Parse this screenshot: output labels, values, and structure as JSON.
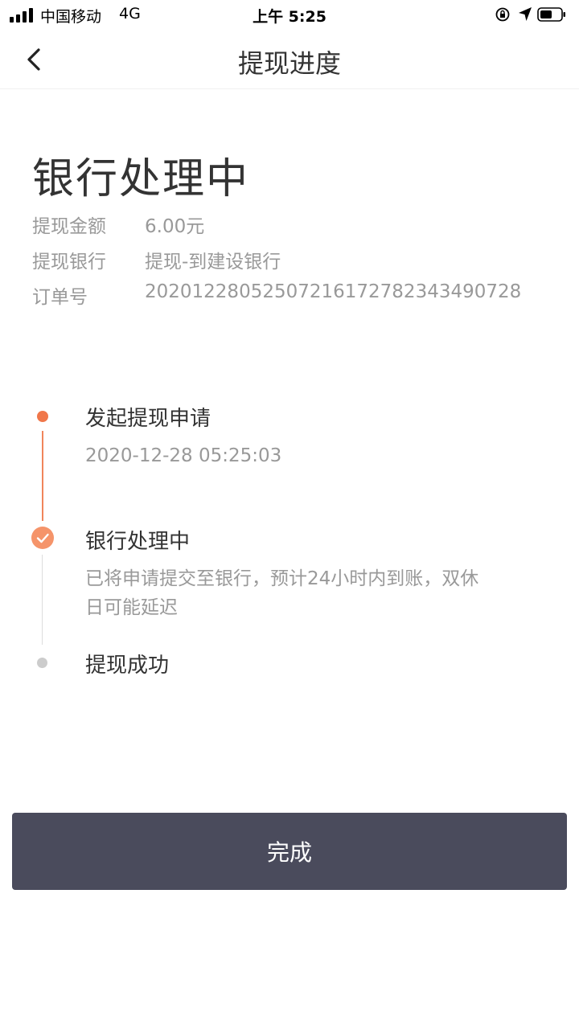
{
  "status_bar": {
    "carrier": "中国移动",
    "network": "4G",
    "time": "上午 5:25"
  },
  "nav": {
    "title": "提现进度",
    "back_icon": "chevron-left-icon"
  },
  "withdrawal": {
    "status": "银行处理中",
    "rows": [
      {
        "label": "提现金额",
        "value": "6.00元"
      },
      {
        "label": "提现银行",
        "value": "提现-到建设银行"
      },
      {
        "label": "订单号",
        "value": "2020122805250721617278234349​0728"
      }
    ]
  },
  "timeline": {
    "steps": [
      {
        "title": "发起提现申请",
        "detail": "2020-12-28 05:25:03",
        "state": "done"
      },
      {
        "title": "银行处理中",
        "detail": "已将申请提交至银行，预计24小时内到账，双休日可能延迟",
        "state": "current"
      },
      {
        "title": "提现成功",
        "detail": "",
        "state": "pending"
      }
    ]
  },
  "button": {
    "label": "完成"
  },
  "colors": {
    "accent": "#f0774a",
    "button_bg": "#4a4b5c",
    "muted_text": "#999999"
  }
}
